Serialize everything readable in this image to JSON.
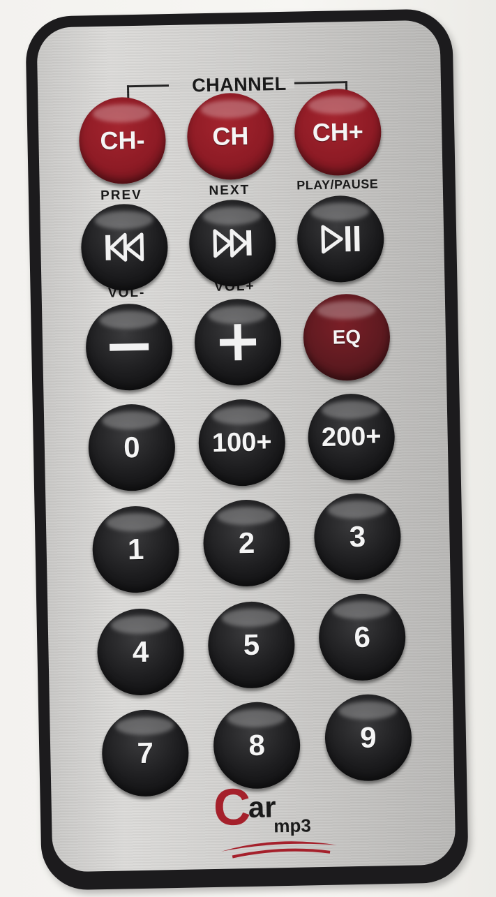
{
  "remote": {
    "group_label": "CHANNEL",
    "labels": {
      "prev": "PREV",
      "next": "NEXT",
      "play_pause": "PLAY/PAUSE",
      "vol_down": "VOL-",
      "vol_up": "VOL+"
    },
    "buttons": {
      "ch_minus": "CH-",
      "ch": "CH",
      "ch_plus": "CH+",
      "eq": "EQ",
      "zero": "0",
      "plus100": "100+",
      "plus200": "200+",
      "one": "1",
      "two": "2",
      "three": "3",
      "four": "4",
      "five": "5",
      "six": "6",
      "seven": "7",
      "eight": "8",
      "nine": "9"
    },
    "icons": {
      "prev": "skip-previous-icon",
      "next": "skip-next-icon",
      "play_pause": "play-pause-icon",
      "vol_down": "minus-icon",
      "vol_up": "plus-icon"
    },
    "brand": {
      "letter": "C",
      "word": "ar",
      "sub": "mp3"
    },
    "colors": {
      "red_button": "#8e1b25",
      "eq_button": "#5e1a20",
      "black_button": "#1c1c1e",
      "face": "#d2d1cf",
      "shell": "#1c1b1d",
      "brand_red": "#a5202b"
    }
  }
}
